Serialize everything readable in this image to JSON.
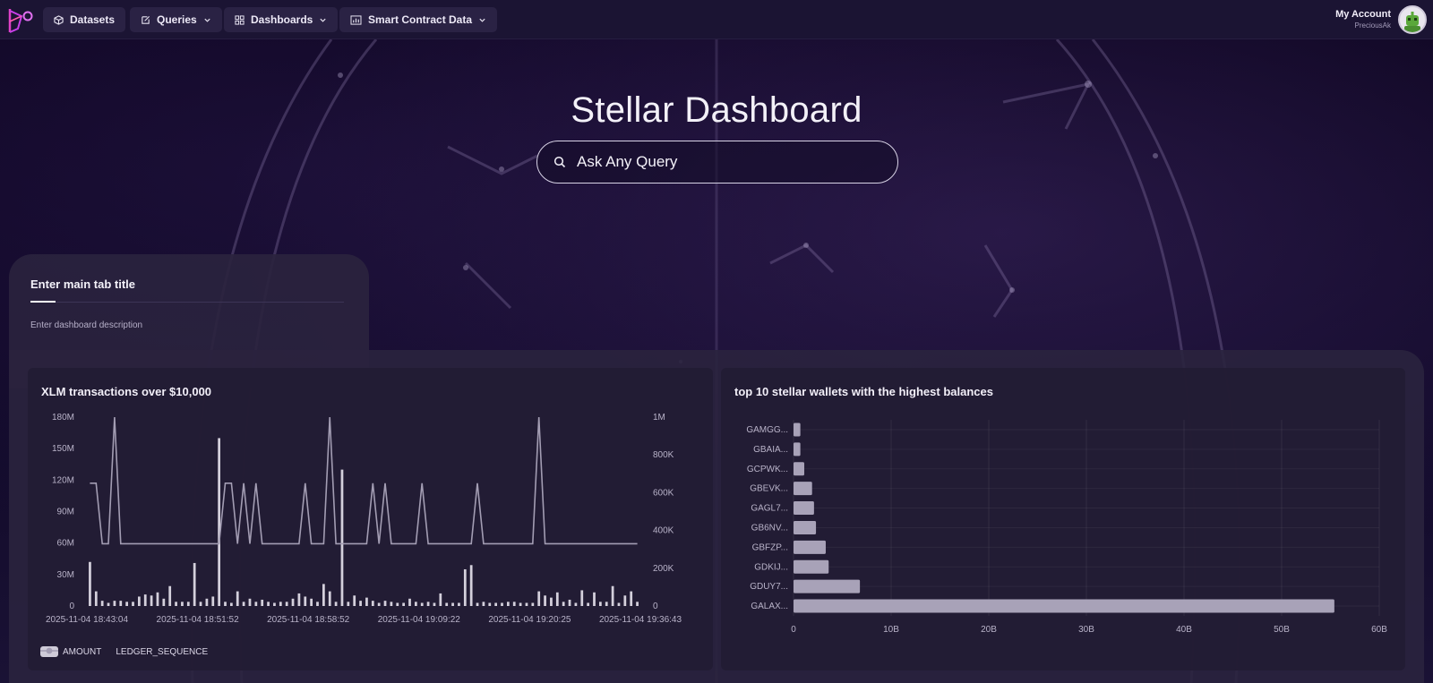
{
  "nav": {
    "items": [
      {
        "label": "Datasets",
        "icon": "cube-icon"
      },
      {
        "label": "Queries",
        "icon": "edit-icon",
        "dropdown": true
      },
      {
        "label": "Dashboards",
        "icon": "grid-icon",
        "dropdown": true
      },
      {
        "label": "Smart Contract Data",
        "icon": "bar-chart-icon",
        "dropdown": true
      }
    ],
    "account": {
      "label": "My Account",
      "username": "PreciousAk"
    }
  },
  "hero": {
    "title": "Stellar Dashboard",
    "search_placeholder": "Ask Any Query"
  },
  "tab": {
    "title": "Enter main tab title",
    "description": "Enter dashboard description"
  },
  "chart_data": [
    {
      "type": "bar",
      "title": "XLM transactions over $10,000",
      "series": [
        {
          "name": "AMOUNT",
          "type": "bar",
          "axis": "left",
          "values": [
            42,
            14,
            5,
            3,
            5,
            5,
            4,
            4,
            9,
            11,
            10,
            13,
            7,
            19,
            4,
            4,
            4,
            41,
            4,
            7,
            9,
            160,
            4,
            3,
            14,
            4,
            7,
            4,
            6,
            4,
            3,
            4,
            4,
            7,
            12,
            9,
            7,
            4,
            21,
            14,
            4,
            130,
            4,
            10,
            5,
            8,
            5,
            3,
            5,
            4,
            3,
            3,
            7,
            4,
            3,
            4,
            3,
            12,
            3,
            3,
            3,
            35,
            39,
            3,
            4,
            3,
            3,
            3,
            4,
            4,
            3,
            3,
            3,
            14,
            10,
            8,
            13,
            4,
            6,
            3,
            15,
            3,
            13,
            4,
            4,
            19,
            3,
            10,
            14,
            4
          ]
        },
        {
          "name": "LEDGER_SEQUENCE",
          "type": "line",
          "axis": "right",
          "values": [
            650000,
            650000,
            330000,
            330000,
            1000000,
            330000,
            330000,
            330000,
            330000,
            330000,
            330000,
            330000,
            330000,
            330000,
            330000,
            330000,
            330000,
            330000,
            330000,
            330000,
            330000,
            330000,
            650000,
            650000,
            330000,
            650000,
            330000,
            650000,
            330000,
            330000,
            330000,
            330000,
            330000,
            330000,
            330000,
            650000,
            330000,
            330000,
            330000,
            1000000,
            330000,
            330000,
            330000,
            330000,
            330000,
            330000,
            650000,
            330000,
            650000,
            330000,
            330000,
            330000,
            330000,
            330000,
            650000,
            330000,
            330000,
            330000,
            330000,
            330000,
            330000,
            330000,
            330000,
            650000,
            330000,
            330000,
            330000,
            330000,
            330000,
            330000,
            330000,
            330000,
            330000,
            1000000,
            330000,
            330000,
            330000,
            330000,
            330000,
            330000,
            330000,
            330000,
            330000,
            330000,
            330000,
            330000,
            330000,
            330000,
            330000,
            330000
          ]
        }
      ],
      "x_ticks": [
        "2025-11-04 18:43:04",
        "2025-11-04 18:51:52",
        "2025-11-04 18:58:52",
        "2025-11-04 19:09:22",
        "2025-11-04 19:20:25",
        "2025-11-04 19:36:43"
      ],
      "y_left_ticks": [
        "0",
        "30M",
        "60M",
        "90M",
        "120M",
        "150M",
        "180M"
      ],
      "y_left_range": [
        0,
        180
      ],
      "y_right_ticks": [
        "0",
        "200K",
        "400K",
        "600K",
        "800K",
        "1M"
      ],
      "y_right_range": [
        0,
        1000000
      ],
      "legend": [
        "AMOUNT",
        "LEDGER_SEQUENCE"
      ],
      "legend_position": "bottom-left",
      "colors": {
        "bar": "#d4d0dc",
        "line": "#a39db3"
      }
    },
    {
      "type": "bar",
      "orientation": "horizontal",
      "title": "top 10 stellar wallets with the highest balances",
      "categories": [
        "GAMGG...",
        "GBAIA...",
        "GCPWK...",
        "GBEVK...",
        "GAGL7...",
        "GB6NV...",
        "GBFZP...",
        "GDKIJ...",
        "GDUY7...",
        "GALAX..."
      ],
      "values": [
        0.7,
        0.7,
        1.1,
        1.9,
        2.1,
        2.3,
        3.3,
        3.6,
        6.8,
        55.4
      ],
      "x_ticks": [
        "0",
        "10B",
        "20B",
        "30B",
        "40B",
        "50B",
        "60B"
      ],
      "xlim": [
        0,
        60
      ],
      "unit": "B",
      "grid": true,
      "colors": {
        "bar": "#a8a2b8"
      }
    }
  ]
}
